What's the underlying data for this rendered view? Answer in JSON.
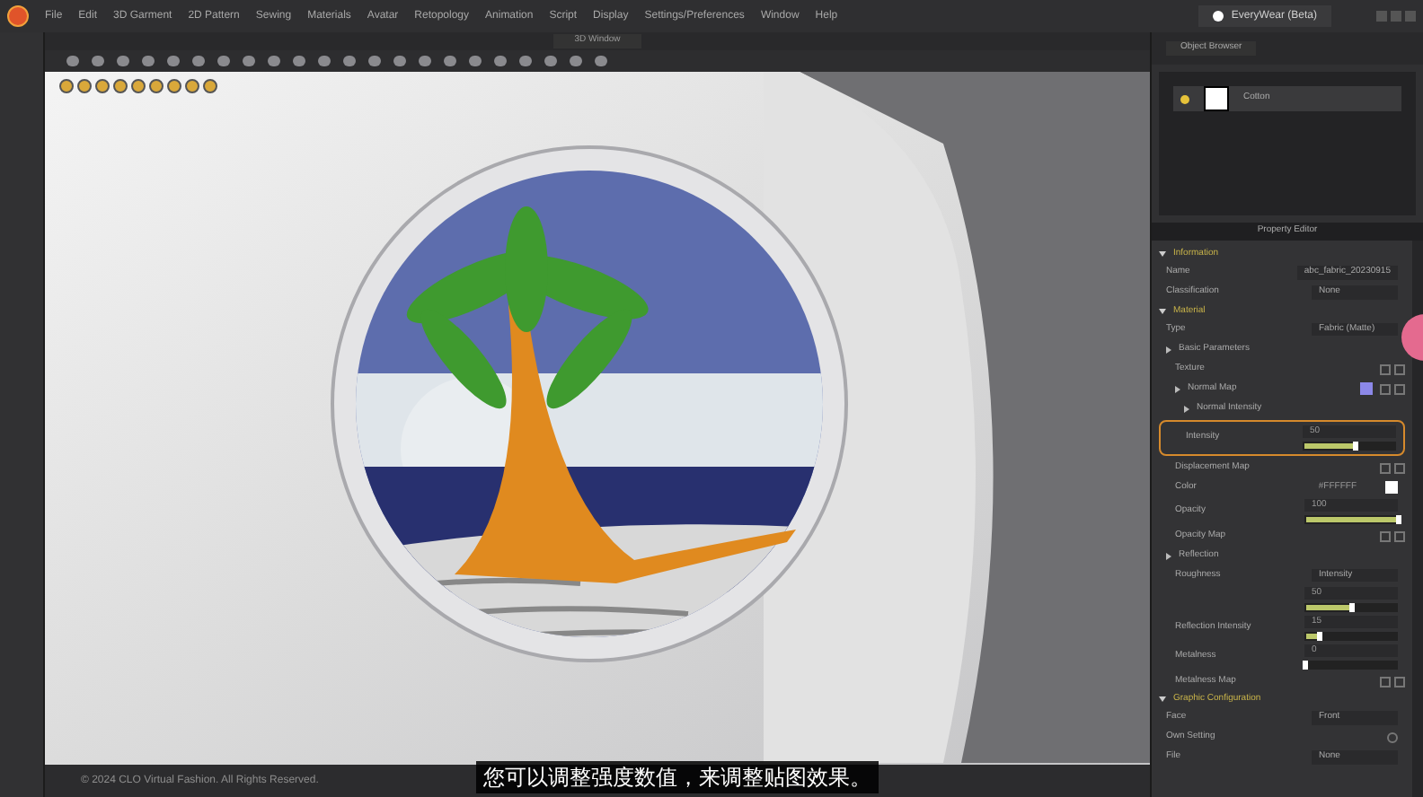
{
  "app_title": "EveryWear (Beta)",
  "menu": [
    "File",
    "Edit",
    "3D Garment",
    "2D Pattern",
    "Sewing",
    "Materials",
    "Avatar",
    "Retopology",
    "Animation",
    "Script",
    "Display",
    "Settings/Preferences",
    "Window",
    "Help"
  ],
  "viewport": {
    "tab": "3D Window",
    "copyright": "© 2024 CLO Virtual Fashion. All Rights Reserved."
  },
  "object_browser": {
    "tab": "Object Browser",
    "items": [
      {
        "label": "Cotton",
        "selected": true
      }
    ]
  },
  "property_editor": {
    "title": "Property Editor",
    "sections": [
      {
        "label": "Information",
        "expanded": true,
        "rows": [
          {
            "kind": "field",
            "label": "Name",
            "value": "abc_fabric_20230915"
          },
          {
            "kind": "select",
            "label": "Classification",
            "value": "None"
          }
        ]
      },
      {
        "label": "Material",
        "expanded": true,
        "rows": [
          {
            "kind": "select",
            "label": "Type",
            "value": "Fabric (Matte)"
          },
          {
            "kind": "group",
            "label": "Basic Parameters",
            "children": [
              {
                "kind": "map",
                "label": "Texture"
              },
              {
                "kind": "map",
                "label": "Normal Map",
                "color": "#8c88e8",
                "children": [
                  {
                    "kind": "group",
                    "label": "Normal Intensity"
                  },
                  {
                    "kind": "slider",
                    "label": "Intensity",
                    "value": "50",
                    "level": 0.55,
                    "highlighted": true
                  }
                ]
              },
              {
                "kind": "map",
                "label": "Displacement Map"
              },
              {
                "kind": "color",
                "label": "Color",
                "value": "#FFFFFF"
              },
              {
                "kind": "slider",
                "label": "Opacity",
                "value": "100",
                "level": 1,
                "highlighted": false
              },
              {
                "kind": "map",
                "label": "Opacity Map"
              }
            ]
          },
          {
            "kind": "group",
            "label": "Reflection",
            "children": [
              {
                "kind": "select",
                "label": "Roughness",
                "value": "Intensity"
              },
              {
                "kind": "slider",
                "value": "50",
                "level": 0.5,
                "highlighted": false
              },
              {
                "kind": "slider",
                "label": "Reflection Intensity",
                "value": "15",
                "level": 0.15,
                "highlighted": false
              },
              {
                "kind": "slider",
                "label": "Metalness",
                "value": "0",
                "level": 0,
                "highlighted": false
              },
              {
                "kind": "map",
                "label": "Metalness Map"
              }
            ]
          }
        ]
      },
      {
        "label": "Graphic Configuration",
        "expanded": true,
        "rows": [
          {
            "kind": "select",
            "label": "Face",
            "value": "Front"
          },
          {
            "kind": "toggle",
            "label": "Own Setting"
          },
          {
            "kind": "select",
            "label": "File",
            "value": "None"
          }
        ]
      }
    ]
  },
  "subtitle": "您可以调整强度数值，来调整贴图效果。"
}
